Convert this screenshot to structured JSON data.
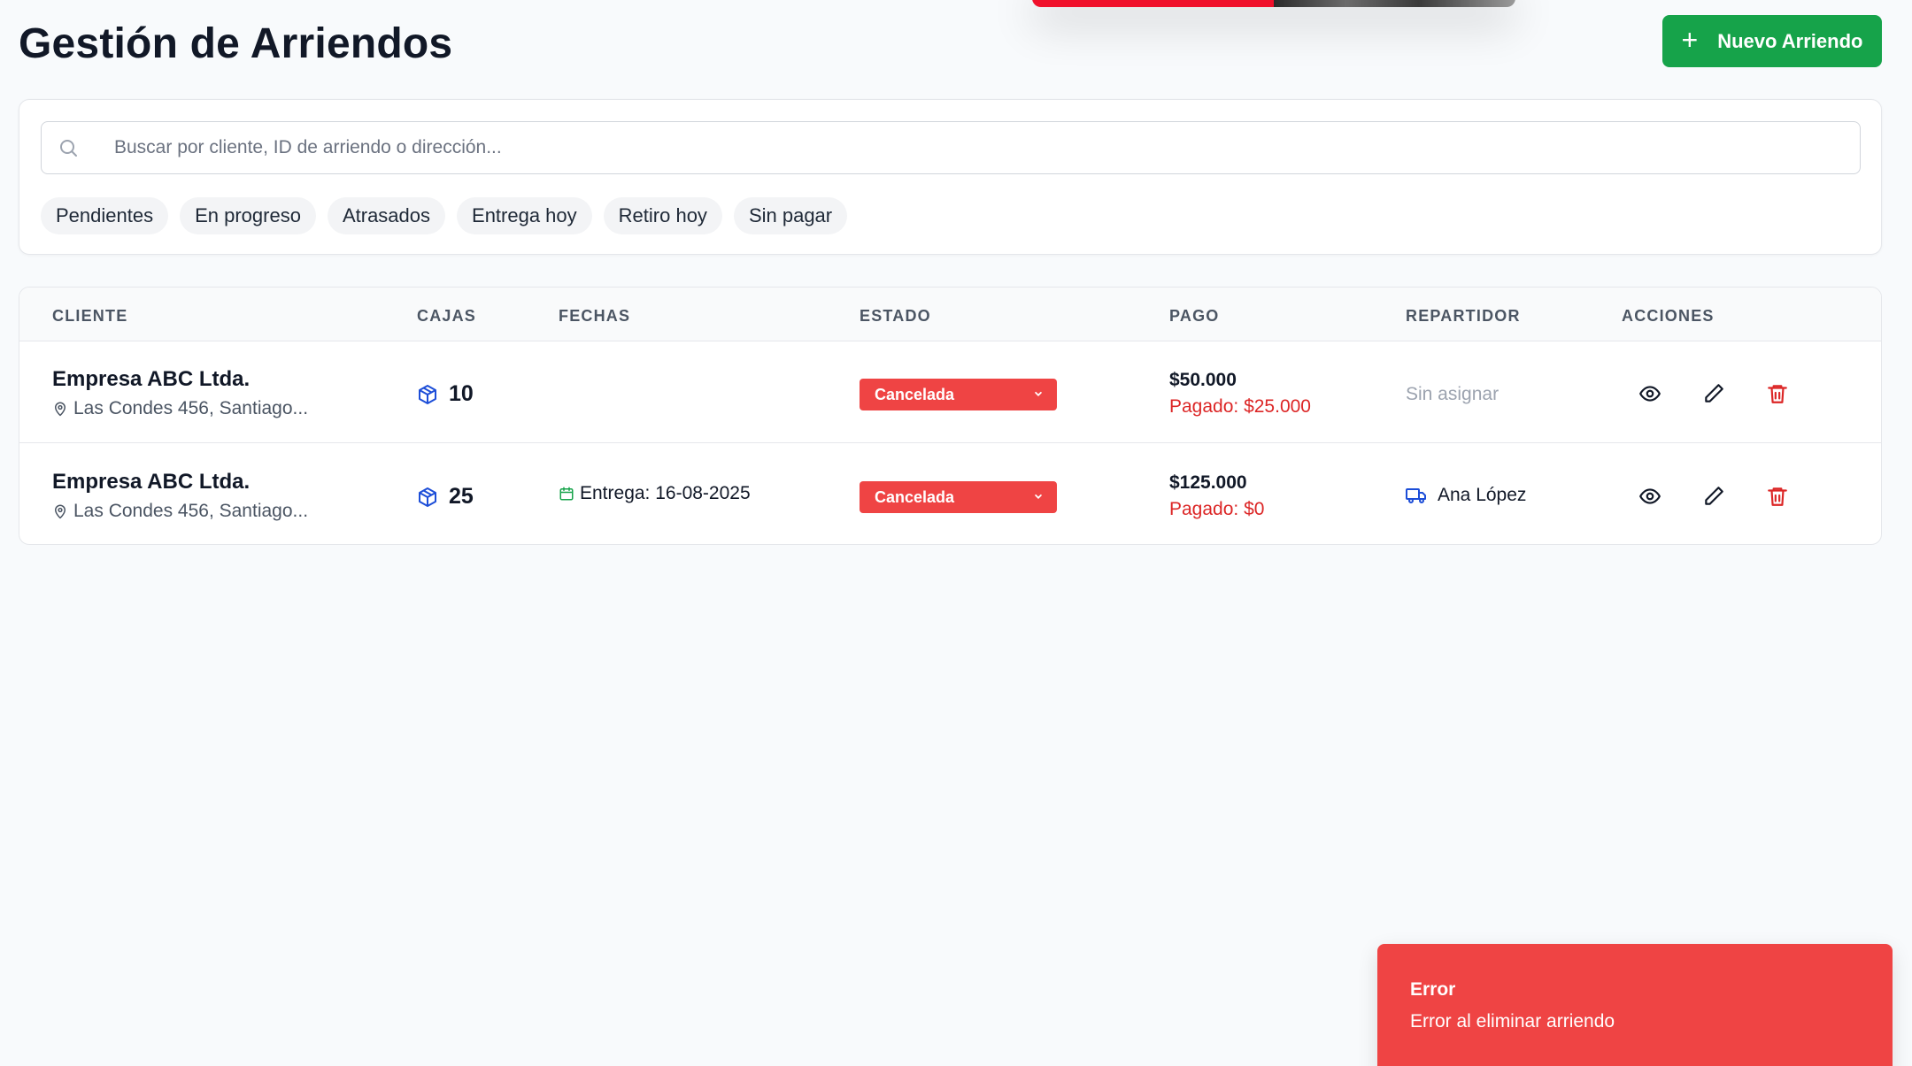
{
  "header": {
    "title": "Gestión de Arriendos",
    "new_button_label": "Nuevo Arriendo"
  },
  "search": {
    "placeholder": "Buscar por cliente, ID de arriendo o dirección...",
    "value": ""
  },
  "filters": [
    "Pendientes",
    "En progreso",
    "Atrasados",
    "Entrega hoy",
    "Retiro hoy",
    "Sin pagar"
  ],
  "table": {
    "columns": [
      "CLIENTE",
      "CAJAS",
      "FECHAS",
      "ESTADO",
      "PAGO",
      "REPARTIDOR",
      "ACCIONES"
    ],
    "rows": [
      {
        "client": "Empresa ABC Ltda.",
        "address": "Las Condes 456, Santiago...",
        "boxes": "10",
        "date": "",
        "status": "Cancelada",
        "total": "$50.000",
        "paid": "Pagado: $25.000",
        "driver": "Sin asignar"
      },
      {
        "client": "Empresa ABC Ltda.",
        "address": "Las Condes 456, Santiago...",
        "boxes": "25",
        "date": "Entrega: 16-08-2025",
        "status": "Cancelada",
        "total": "$125.000",
        "paid": "Pagado: $0",
        "driver": "Ana López"
      }
    ]
  },
  "toast": {
    "title": "Error",
    "message": "Error al eliminar arriendo"
  },
  "colors": {
    "primary_green": "#16a34a",
    "danger_red": "#ef4444",
    "paid_red": "#dc2626",
    "box_blue": "#1d4ed8"
  }
}
